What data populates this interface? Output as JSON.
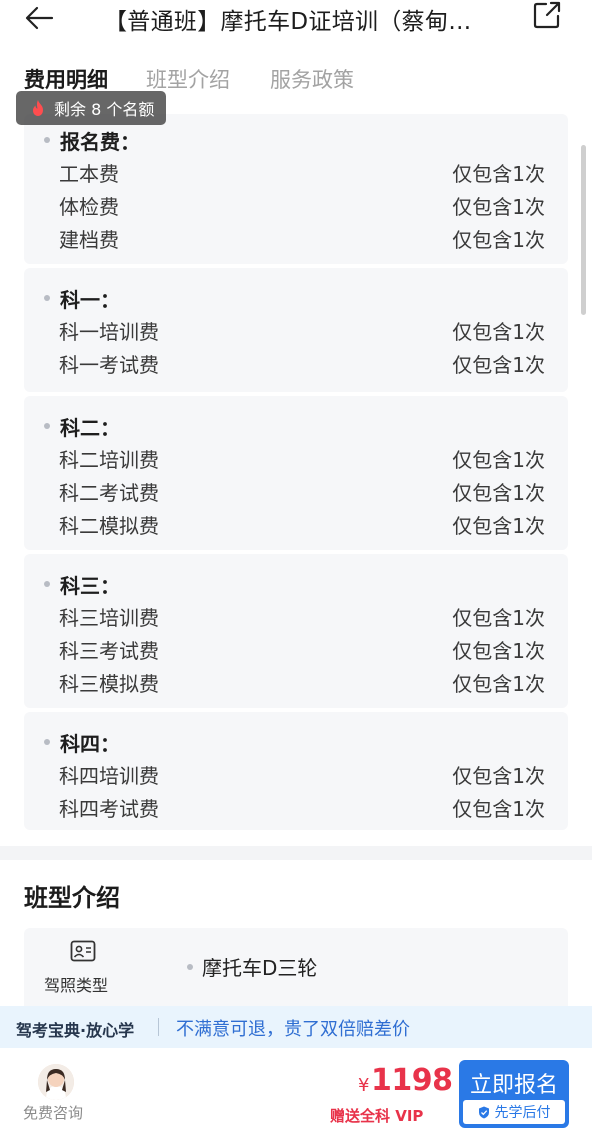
{
  "header": {
    "title": "【普通班】摩托车D证培训（蔡甸…"
  },
  "tabs": [
    {
      "label": "费用明细",
      "active": true
    },
    {
      "label": "班型介绍",
      "active": false
    },
    {
      "label": "服务政策",
      "active": false
    }
  ],
  "badge": {
    "text": "剩余 8 个名额",
    "icon": "fire-icon"
  },
  "fee_sections": [
    {
      "title": "报名费：",
      "items": [
        {
          "name": "工本费",
          "value": "仅包含1次"
        },
        {
          "name": "体检费",
          "value": "仅包含1次"
        },
        {
          "name": "建档费",
          "value": "仅包含1次"
        }
      ]
    },
    {
      "title": "科一：",
      "items": [
        {
          "name": "科一培训费",
          "value": "仅包含1次"
        },
        {
          "name": "科一考试费",
          "value": "仅包含1次"
        }
      ]
    },
    {
      "title": "科二：",
      "items": [
        {
          "name": "科二培训费",
          "value": "仅包含1次"
        },
        {
          "name": "科二考试费",
          "value": "仅包含1次"
        },
        {
          "name": "科二模拟费",
          "value": "仅包含1次"
        }
      ]
    },
    {
      "title": "科三：",
      "items": [
        {
          "name": "科三培训费",
          "value": "仅包含1次"
        },
        {
          "name": "科三考试费",
          "value": "仅包含1次"
        },
        {
          "name": "科三模拟费",
          "value": "仅包含1次"
        }
      ]
    },
    {
      "title": "科四：",
      "items": [
        {
          "name": "科四培训费",
          "value": "仅包含1次"
        },
        {
          "name": "科四考试费",
          "value": "仅包含1次"
        }
      ]
    }
  ],
  "class_intro": {
    "title": "班型介绍",
    "license_label": "驾照类型",
    "license_value": "摩托车D三轮"
  },
  "promo": {
    "brand": "驾考宝典·放心学",
    "text": "不满意可退，贵了双倍赔差价"
  },
  "bottom": {
    "consult_label": "免费咨询",
    "currency": "¥",
    "price": "1198",
    "vip_text": "赠送全科 VIP",
    "signup_label": "立即报名",
    "pay_later_label": "先学后付"
  },
  "colors": {
    "accent_blue": "#2a79e6",
    "price_red": "#e8334a",
    "promo_bg": "#e9f4fd",
    "section_bg": "#f6f7f9"
  }
}
